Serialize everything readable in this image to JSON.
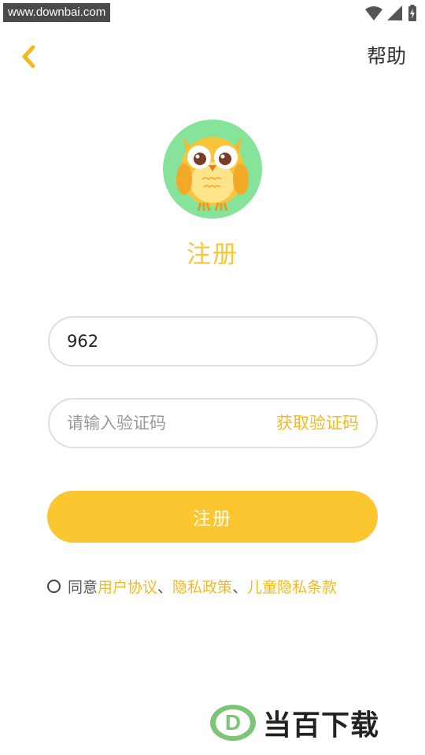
{
  "status_bar": {
    "watermark_url": "www.downbai.com",
    "icons": [
      "wifi-icon",
      "signal-icon",
      "battery-icon"
    ]
  },
  "nav": {
    "back_icon": "chevron-left-icon",
    "help_label": "帮助"
  },
  "logo": {
    "icon": "owl-icon",
    "bg_color": "#86e39a"
  },
  "title": "注册",
  "phone_field": {
    "value": "962",
    "placeholder": ""
  },
  "code_field": {
    "value": "",
    "placeholder": "请输入验证码",
    "get_code_label": "获取验证码"
  },
  "register_button": {
    "label": "注册"
  },
  "agreement": {
    "prefix": "同意",
    "user_agreement": "用户协议",
    "sep1": "、",
    "privacy_policy": "隐私政策",
    "sep2": "、",
    "children_privacy": "儿童隐私条款"
  },
  "brand": {
    "text": "当百下载",
    "logo_letter": "D"
  },
  "colors": {
    "accent": "#fbc630",
    "link": "#f5b91e",
    "logo_bg": "#86e39a",
    "brand_green": "#7cc576"
  }
}
